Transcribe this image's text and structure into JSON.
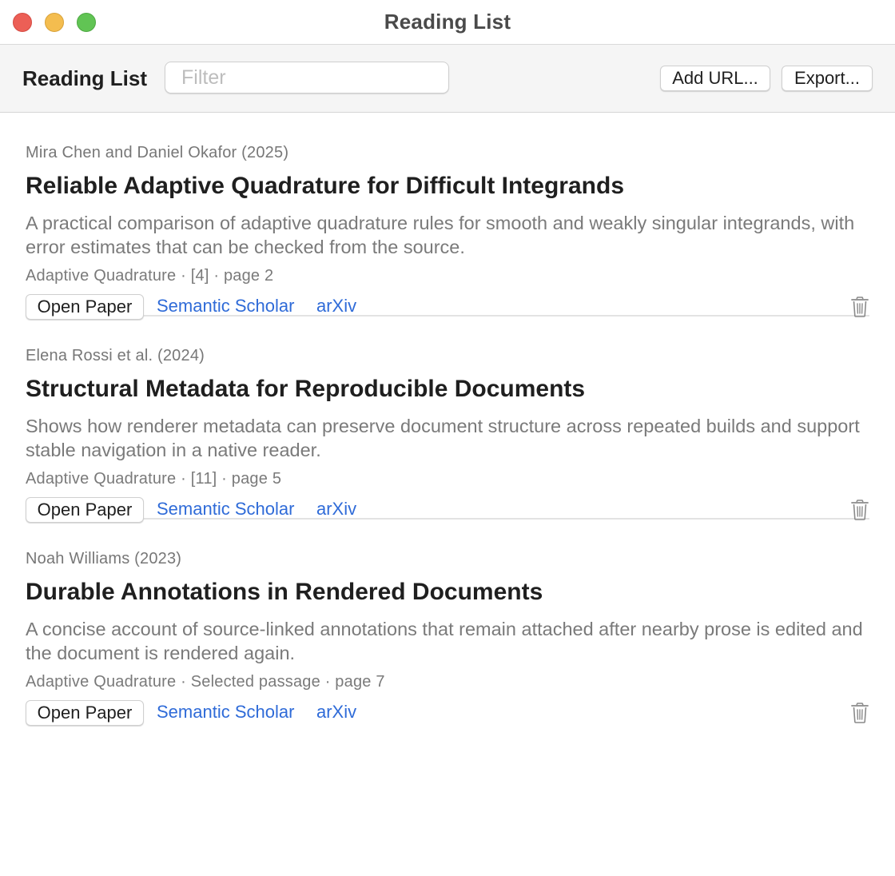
{
  "window": {
    "title": "Reading List"
  },
  "toolbar": {
    "title": "Reading List",
    "filter_placeholder": "Filter",
    "filter_value": "",
    "add_url_label": "Add URL...",
    "export_label": "Export..."
  },
  "items": [
    {
      "authors": "Mira Chen and Daniel Okafor (2025)",
      "title": "Reliable Adaptive Quadrature for Difficult Integrands",
      "summary": "A practical comparison of adaptive quadrature rules for smooth and weakly singular integrands, with error estimates that can be checked from the source.",
      "meta": "Adaptive Quadrature · [4] · page 2",
      "open_label": "Open Paper",
      "semantic_scholar_label": "Semantic Scholar",
      "arxiv_label": "arXiv",
      "delete_icon": "trash-icon"
    },
    {
      "authors": "Elena Rossi et al. (2024)",
      "title": "Structural Metadata for Reproducible Documents",
      "summary": "Shows how renderer metadata can preserve document structure across repeated builds and support stable navigation in a native reader.",
      "meta": "Adaptive Quadrature · [11] · page 5",
      "open_label": "Open Paper",
      "semantic_scholar_label": "Semantic Scholar",
      "arxiv_label": "arXiv",
      "delete_icon": "trash-icon"
    },
    {
      "authors": "Noah Williams (2023)",
      "title": "Durable Annotations in Rendered Documents",
      "summary": "A concise account of source-linked annotations that remain attached after nearby prose is edited and the document is rendered again.",
      "meta": "Adaptive Quadrature · Selected passage · page 7",
      "open_label": "Open Paper",
      "semantic_scholar_label": "Semantic Scholar",
      "arxiv_label": "arXiv",
      "delete_icon": "trash-icon"
    }
  ],
  "colors": {
    "link": "#2f6bd8",
    "close": "#ec5f56",
    "minimize": "#f4bd4f",
    "maximize": "#61c454"
  }
}
